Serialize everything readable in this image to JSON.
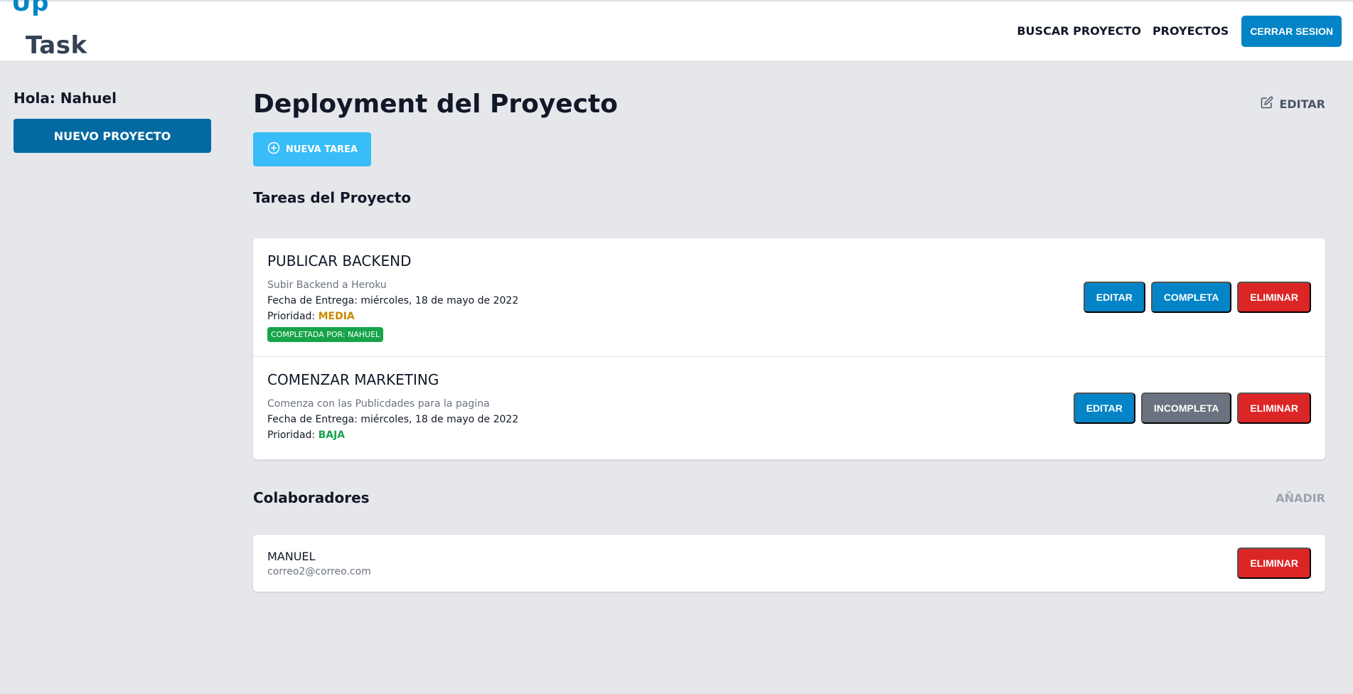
{
  "header": {
    "logo_up": "Up",
    "logo_task": "Task",
    "nav": [
      "BUSCAR PROYECTO",
      "PROYECTOS"
    ],
    "logout_label": "CERRAR SESION"
  },
  "sidebar": {
    "greeting": "Hola: Nahuel",
    "new_project_label": "NUEVO PROYECTO"
  },
  "main": {
    "title": "Deployment del Proyecto",
    "edit_label": "EDITAR",
    "new_task_label": "NUEVA TAREA",
    "tasks_title": "Tareas del Proyecto",
    "tasks": [
      {
        "name": "PUBLICAR BACKEND",
        "description": "Subir Backend a Heroku",
        "date_label": "Fecha de Entrega: ",
        "date": "miércoles, 18 de mayo de 2022",
        "priority_label": "Prioridad: ",
        "priority": "MEDIA",
        "badge": "COMPLETADA POR: NAHUEL",
        "btn_edit": "EDITAR",
        "btn_state": "COMPLETA",
        "btn_delete": "ELIMINAR"
      },
      {
        "name": "COMENZAR MARKETING",
        "description": "Comenza con las Publicdades para la pagina",
        "date_label": "Fecha de Entrega: ",
        "date": "miércoles, 18 de mayo de 2022",
        "priority_label": "Prioridad: ",
        "priority": "BAJA",
        "btn_edit": "EDITAR",
        "btn_state": "INCOMPLETA",
        "btn_delete": "ELIMINAR"
      }
    ],
    "collab_title": "Colaboradores",
    "add_label": "AÑADIR",
    "collaborators": [
      {
        "name": "MANUEL",
        "email": "correo2@correo.com",
        "btn_delete": "ELIMINAR"
      }
    ]
  },
  "colors": {
    "primary": "#0284c7",
    "sky": "#38bdf8",
    "danger": "#dc2626",
    "success": "#16a34a",
    "warning": "#ca8a04",
    "neutral": "#6b7280",
    "background": "#e5e7eb"
  },
  "icons": {
    "edit": "pencil-square-icon",
    "new_task": "plus-circle-icon"
  }
}
